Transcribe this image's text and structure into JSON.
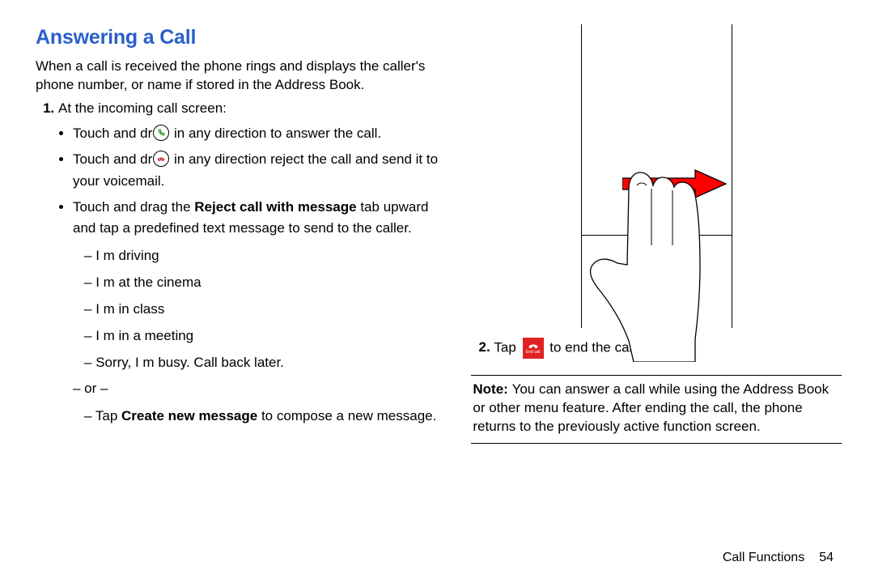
{
  "heading": "Answering a Call",
  "intro": "When a call is received the phone rings and displays the caller's phone number, or name if stored in the Address Book.",
  "step1": "At the incoming call screen:",
  "b1_a": "Touch and dr",
  "b1_b": " in any direction to answer the call.",
  "b2_a": "Touch and dr",
  "b2_b": " in any direction reject the call and send it to your voicemail.",
  "b3_a": "Touch and drag the ",
  "b3_bold": "Reject call with message",
  "b3_b": " tab upward and tap a predefined text message to send to the caller.",
  "msgs": {
    "m1": "I m driving",
    "m2": "I m at the cinema",
    "m3": "I m in class",
    "m4": "I m in a meeting",
    "m5": "Sorry, I m busy. Call back later."
  },
  "or": "– or –",
  "create_a": "Tap ",
  "create_bold": "Create new message",
  "create_b": " to compose a new message.",
  "step2_a": "Tap ",
  "step2_b": " to end the call.",
  "end_label": "End call",
  "note_label": "Note: ",
  "note_body": "You can answer a call while using the Address Book or other menu feature. After ending the call, the phone returns to the previously active function screen.",
  "footer_section": "Call Functions",
  "footer_page": "54"
}
